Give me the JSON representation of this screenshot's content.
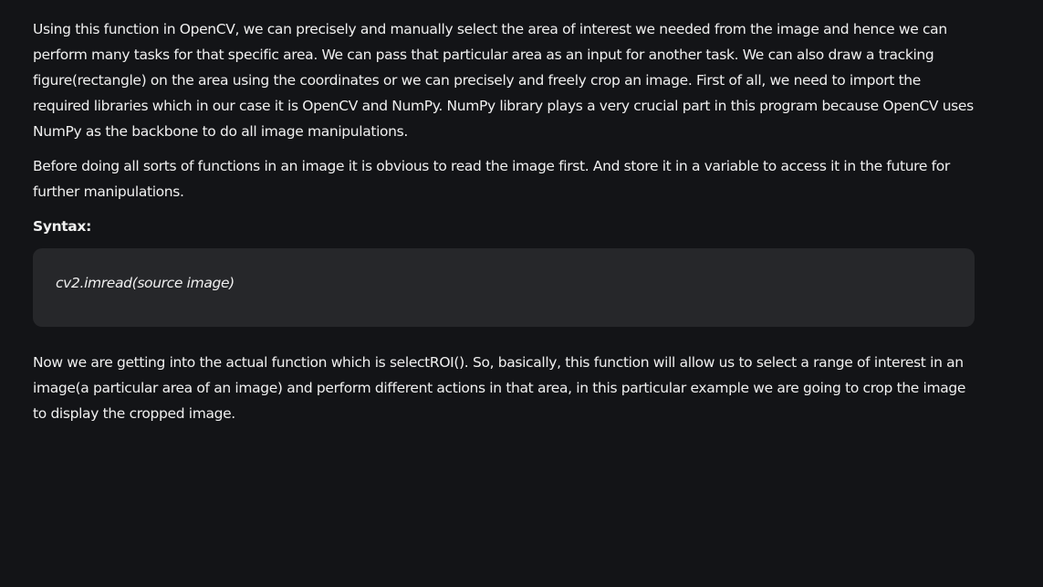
{
  "article": {
    "paragraph_1": "Using this function in OpenCV, we can precisely and manually select the area of interest we needed from the image and hence we can perform many tasks for that specific area. We can pass that particular area as an input for another task. We can also draw a tracking figure(rectangle) on the area using the coordinates or we can precisely and freely crop an image. First of all, we need to import the required libraries which in our case it is OpenCV and NumPy. NumPy library plays a very crucial part in this program because OpenCV uses NumPy as the backbone to do all image manipulations.",
    "paragraph_2": "Before doing all sorts of functions in an image it is obvious to read the image first. And store it in a variable to access it in the future for further manipulations.",
    "syntax_label": "Syntax:",
    "code": "cv2.imread(source image)",
    "paragraph_3": "Now we are getting into the actual function which is selectROI(). So, basically, this function will allow us to select a range of interest in an image(a particular area of an image) and perform different actions in that area, in this particular example we are going to crop the image to display the cropped image."
  },
  "colors": {
    "background": "#131417",
    "text": "#f0f0f0",
    "code_background": "#26272a"
  }
}
